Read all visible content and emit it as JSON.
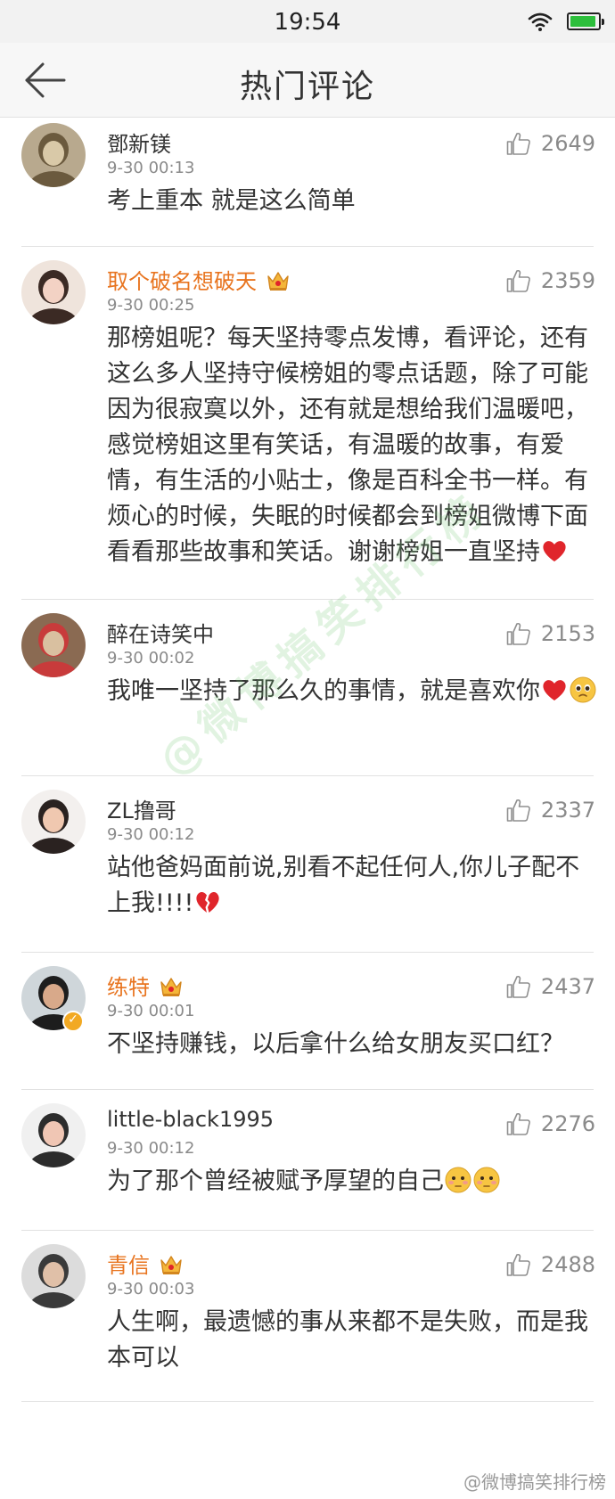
{
  "status": {
    "time": "19:54",
    "battery_level": 0.95,
    "wifi_icon": "wifi-icon",
    "battery_icon": "battery-icon"
  },
  "header": {
    "title": "热门评论",
    "back_icon": "back-arrow-icon"
  },
  "comments": [
    {
      "username": "鄧新镁",
      "vip": false,
      "verified": false,
      "time": "9-30 00:13",
      "likes": "2649",
      "text": "考上重本 就是这么简单",
      "emoji_after": []
    },
    {
      "username": "取个破名想破天",
      "vip": true,
      "verified": false,
      "time": "9-30 00:25",
      "likes": "2359",
      "text": "那榜姐呢？每天坚持零点发博，看评论，还有这么多人坚持守候榜姐的零点话题，除了可能因为很寂寞以外，还有就是想给我们温暖吧，感觉榜姐这里有笑话，有温暖的故事，有爱情，有生活的小贴士，像是百科全书一样。有烦心的时候，失眠的时候都会到榜姐微博下面看看那些故事和笑话。谢谢榜姐一直坚持",
      "emoji_after": [
        "heart"
      ]
    },
    {
      "username": "醉在诗笑中",
      "vip": false,
      "verified": false,
      "time": "9-30 00:02",
      "likes": "2153",
      "text": "我唯一坚持了那么久的事情，就是喜欢你",
      "emoji_after": [
        "heart",
        "pleading-face"
      ]
    },
    {
      "username": "ZL撸哥",
      "vip": false,
      "verified": false,
      "time": "9-30 00:12",
      "likes": "2337",
      "text": "站他爸妈面前说,别看不起任何人,你儿子配不上我!!!!",
      "emoji_after": [
        "broken-heart"
      ]
    },
    {
      "username": "练特",
      "vip": true,
      "verified": true,
      "time": "9-30 00:01",
      "likes": "2437",
      "text": "不坚持赚钱，以后拿什么给女朋友买口红？",
      "emoji_after": []
    },
    {
      "username": "little-black1995",
      "vip": false,
      "verified": false,
      "time": "9-30 00:12",
      "likes": "2276",
      "text": "为了那个曾经被赋予厚望的自己",
      "emoji_after": [
        "flushed-face",
        "flushed-face"
      ]
    },
    {
      "username": "青信",
      "vip": true,
      "verified": false,
      "time": "9-30 00:03",
      "likes": "2488",
      "text": "人生啊，最遗憾的事从来都不是失败，而是我本可以",
      "emoji_after": []
    }
  ],
  "watermark": {
    "diagonal": "@微博搞笑排行榜",
    "footer": "@微博搞笑排行榜"
  },
  "colors": {
    "vip_name": "#e8741f",
    "text": "#333333",
    "meta": "#8a8a8a",
    "divider": "#e2e2e2",
    "heart": "#e0252b"
  }
}
